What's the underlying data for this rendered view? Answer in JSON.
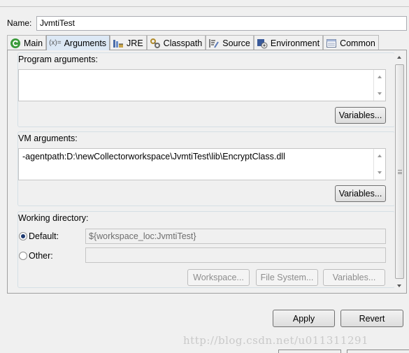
{
  "name_row": {
    "label": "Name:",
    "value": "JvmtiTest"
  },
  "tabs": [
    {
      "label": "Main",
      "icon": "main-launch-icon",
      "active": false
    },
    {
      "label": "Arguments",
      "icon": "arguments-icon",
      "icon_text": "(x)=",
      "active": true
    },
    {
      "label": "JRE",
      "icon": "jre-icon",
      "active": false
    },
    {
      "label": "Classpath",
      "icon": "classpath-icon",
      "active": false
    },
    {
      "label": "Source",
      "icon": "source-icon",
      "active": false
    },
    {
      "label": "Environment",
      "icon": "environment-icon",
      "active": false
    },
    {
      "label": "Common",
      "icon": "common-icon",
      "active": false
    }
  ],
  "program_args": {
    "title": "Program arguments:",
    "value": "",
    "variables_button": "Variables..."
  },
  "vm_args": {
    "title": "VM arguments:",
    "value": "-agentpath:D:\\newCollectorworkspace\\JvmtiTest\\lib\\EncryptClass.dll",
    "variables_button": "Variables..."
  },
  "working_dir": {
    "title": "Working directory:",
    "default_label": "Default:",
    "default_value": "${workspace_loc:JvmtiTest}",
    "default_selected": true,
    "other_label": "Other:",
    "other_value": "",
    "workspace_button": "Workspace...",
    "filesystem_button": "File System...",
    "variables_button": "Variables..."
  },
  "footer": {
    "apply": "Apply",
    "revert": "Revert"
  },
  "watermark": "http://blog.csdn.net/u011311291",
  "colors": {
    "active_tab": "#dce8f5",
    "background": "#f0f0f0",
    "main_icon": "#3a9a3a"
  }
}
